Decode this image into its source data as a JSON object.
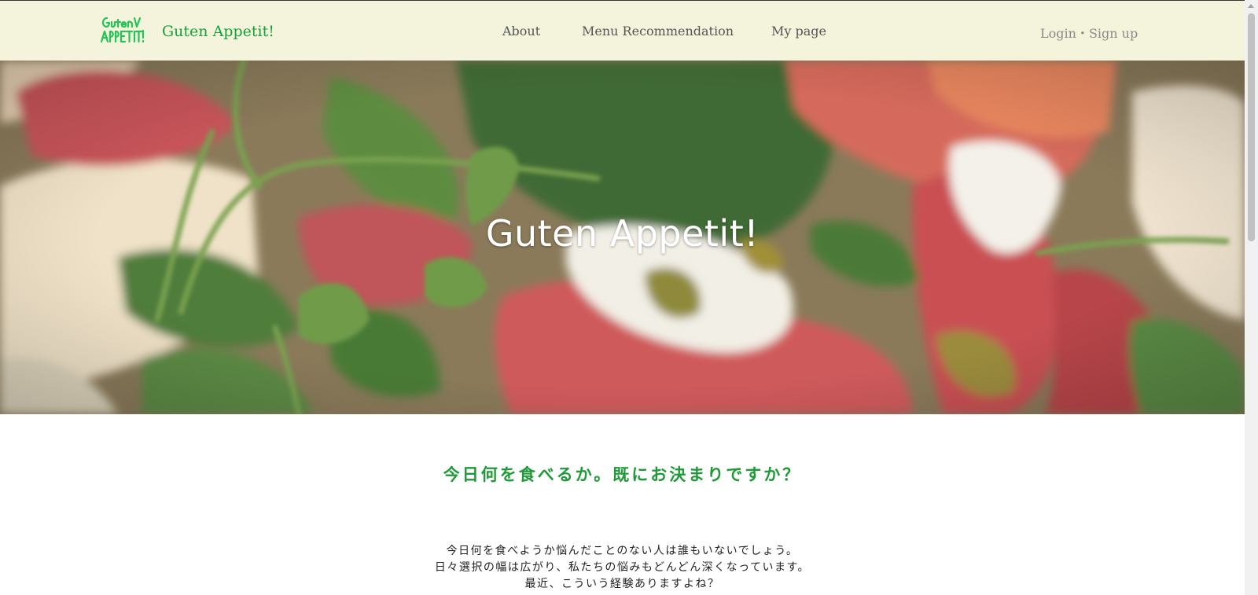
{
  "header": {
    "brand_name": "Guten Appetit!",
    "logo_icon": "guten-appetit-logo-icon",
    "nav": {
      "about": "About",
      "menu_recommendation": "Menu Recommendation",
      "my_page": "My page"
    },
    "auth": {
      "login": "Login",
      "separator": "・",
      "signup": "Sign up"
    }
  },
  "hero": {
    "title": "Guten Appetit!"
  },
  "main": {
    "question": "今日何を食べるか。既にお決まりですか？",
    "intro_lines": [
      "今日何を食べようか悩んだことのない人は誰もいないでしょう。",
      "日々選択の幅は広がり、私たちの悩みもどんどん深くなっています。",
      "最近、こういう経験ありますよね？"
    ]
  },
  "colors": {
    "header_bg": "#f4f4dc",
    "brand_green": "#17a13a",
    "question_green": "#1e9a37",
    "nav_text": "#555555",
    "auth_text": "#8a8a8a"
  }
}
